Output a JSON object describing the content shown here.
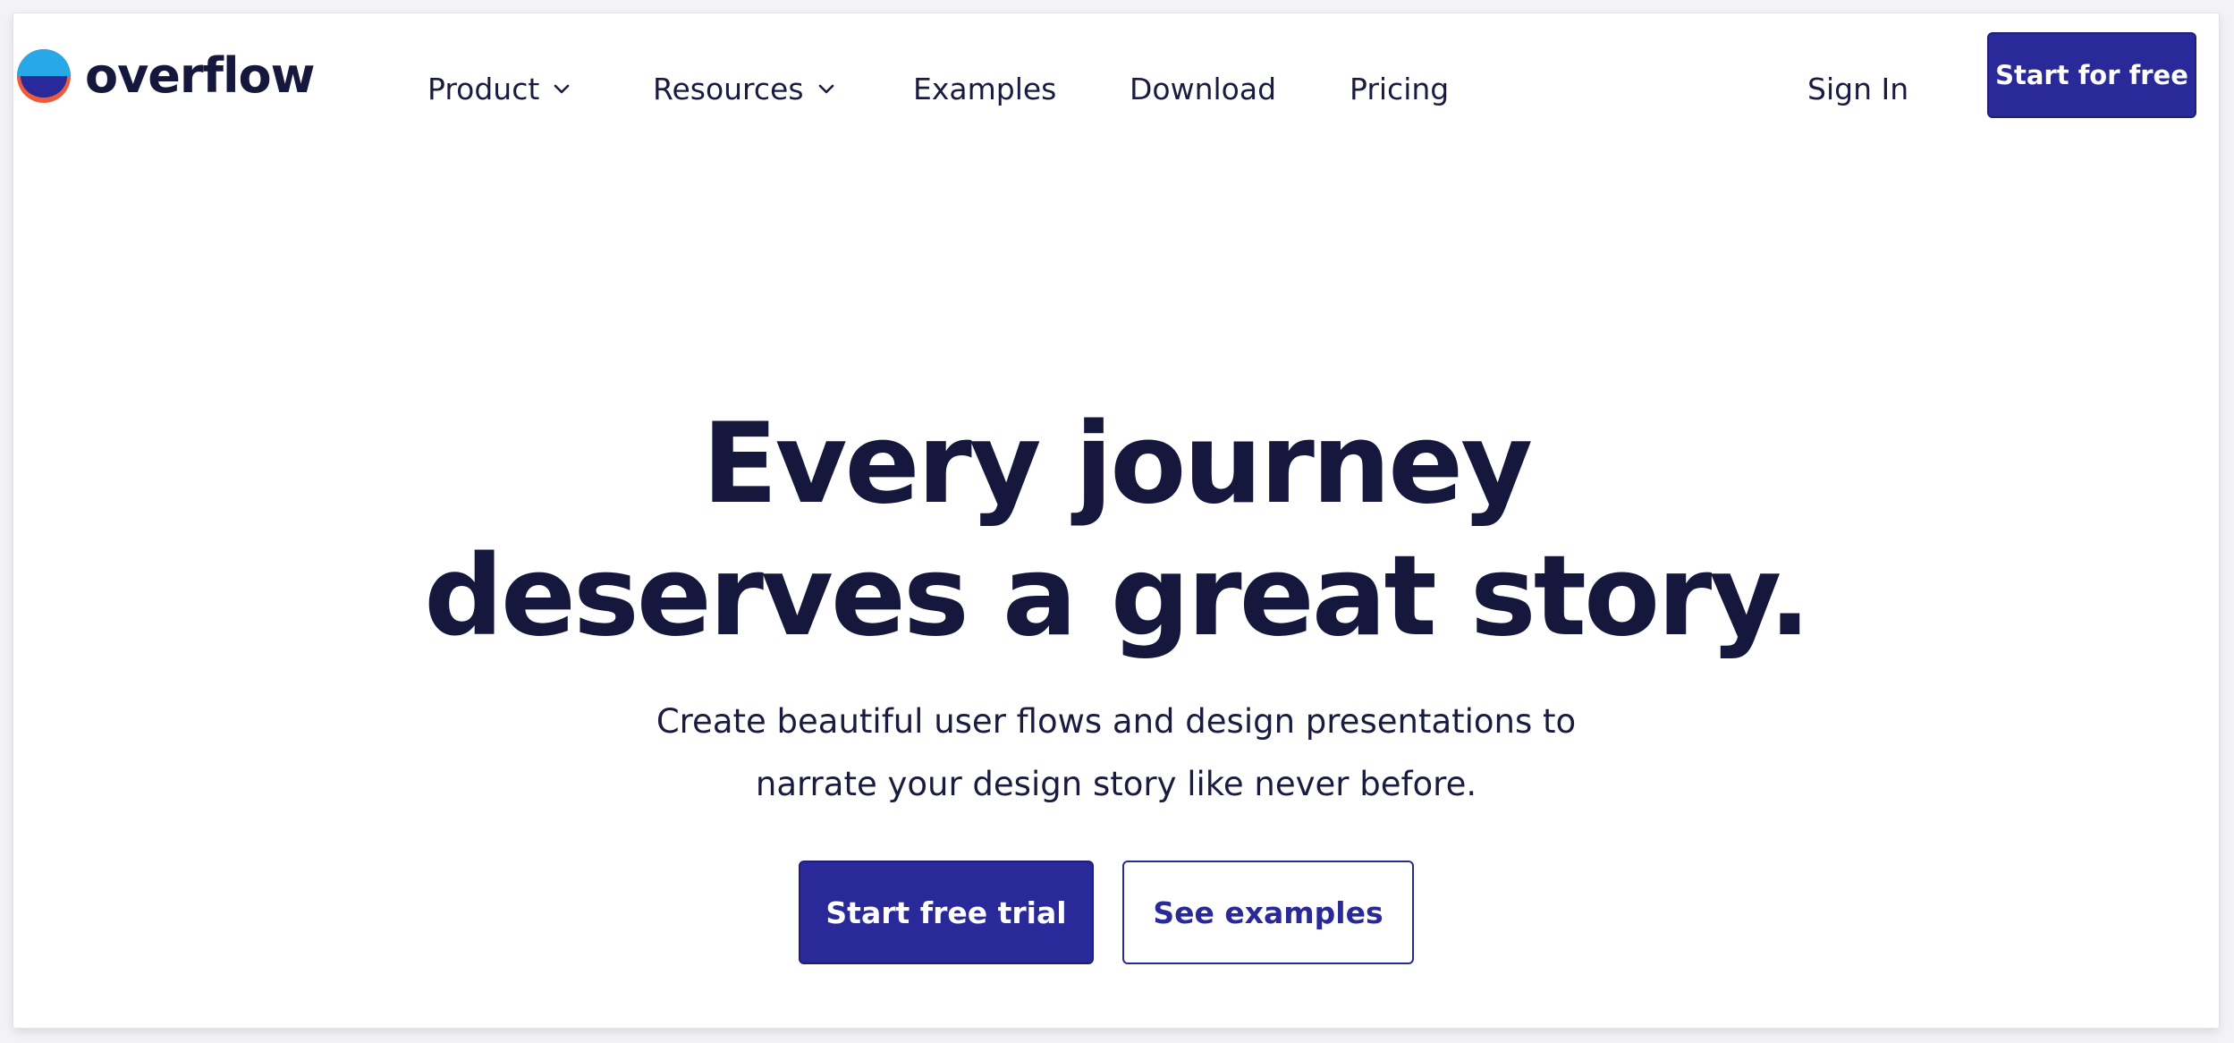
{
  "brand": {
    "name": "overflow",
    "logo_colors": {
      "top": "#27a9e8",
      "middle": "#29299a",
      "bottom": "#f05a3a"
    }
  },
  "nav": {
    "items": [
      {
        "label": "Product",
        "has_dropdown": true,
        "icon": "chevron-down-icon"
      },
      {
        "label": "Resources",
        "has_dropdown": true,
        "icon": "chevron-down-icon"
      },
      {
        "label": "Examples",
        "has_dropdown": false
      },
      {
        "label": "Download",
        "has_dropdown": false
      },
      {
        "label": "Pricing",
        "has_dropdown": false
      }
    ],
    "sign_in": "Sign In",
    "cta": "Start for free"
  },
  "hero": {
    "title_lines": [
      "Every journey",
      "deserves a great story."
    ],
    "subtitle_lines": [
      "Create beautiful user flows and design presentations to",
      "narrate your design story like never before."
    ],
    "primary_cta": "Start free trial",
    "secondary_cta": "See examples"
  },
  "colors": {
    "accent": "#29299a",
    "text": "#15173d",
    "background": "#ffffff"
  }
}
